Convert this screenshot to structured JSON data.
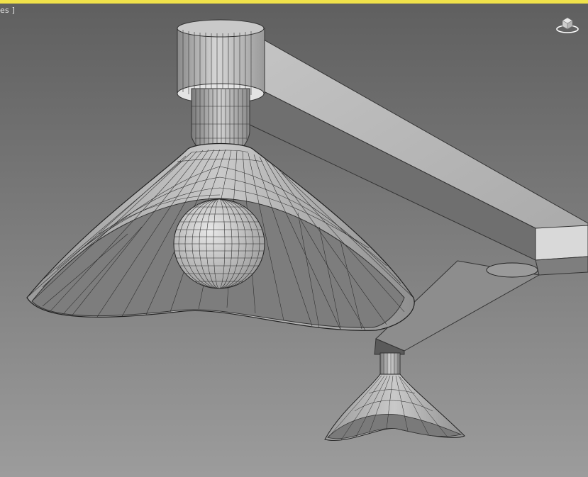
{
  "viewport": {
    "label": "es ]",
    "border_color": "#f1e24a",
    "background_top": "#5f5f5f",
    "background_bottom": "#9c9c9c"
  },
  "viewcube": {
    "icon": "viewcube-home-icon"
  }
}
